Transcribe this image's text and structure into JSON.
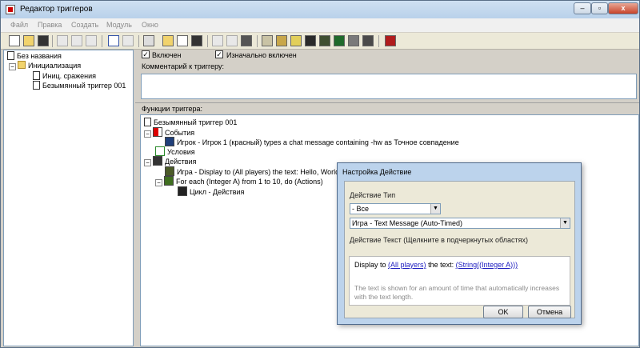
{
  "window": {
    "title": "Редактор триггеров"
  },
  "menu": [
    "Файл",
    "Правка",
    "Создать",
    "Модуль",
    "Окно"
  ],
  "tree": {
    "root": "Без названия",
    "category": "Инициализация",
    "items": [
      "Иниц. сражения",
      "Безымянный триггер 001"
    ]
  },
  "trigger": {
    "enabled_label": "Включен",
    "initially_on_label": "Изначально включен",
    "comment_label": "Комментарий к триггеру:",
    "functions_label": "Функции триггера:"
  },
  "functions": {
    "name": "Безымянный триггер 001",
    "events_label": "События",
    "event": "Игрок - Игрок 1 (красный) types a chat message containing -hw as Точное совпадение",
    "conditions_label": "Условия",
    "actions_label": "Действия",
    "action1": "Игра - Display to (All players) the text: Hello, World!",
    "action2": "For each (Integer A) from 1 to 10, do (Actions)",
    "loop_label": "Цикл - Действия"
  },
  "dialog": {
    "title": "Настройка Действие",
    "type_label": "Действие Тип",
    "type_value": "- Все",
    "action_value": "Игра - Text Message (Auto-Timed)",
    "text_label": "Действие Текст (Щелкните в подчеркнутых областях)",
    "display_prefix": "Display to",
    "link_players": "(All players)",
    "the_text": "the text:",
    "link_string": "(String((Integer A)))",
    "hint": "The text is shown for an amount of time that automatically increases with the text length.",
    "ok": "OK",
    "cancel": "Отмена"
  }
}
